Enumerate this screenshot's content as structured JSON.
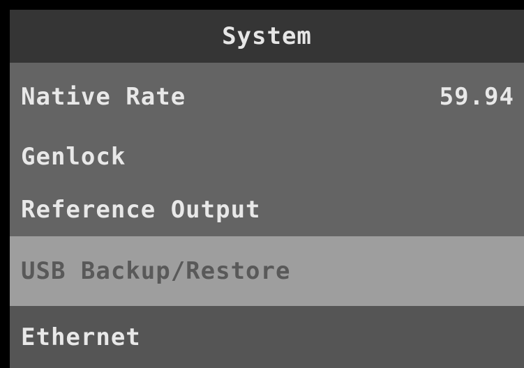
{
  "header": {
    "title": "System"
  },
  "menu": {
    "items": [
      {
        "label": "Native Rate",
        "value": "59.94"
      },
      {
        "label": "Genlock",
        "value": ""
      },
      {
        "label": "Reference Output",
        "value": ""
      },
      {
        "label": "USB Backup/Restore",
        "value": "",
        "selected": true
      },
      {
        "label": "Ethernet",
        "value": ""
      }
    ]
  },
  "colors": {
    "background": "#646464",
    "title_bar": "#353535",
    "selected_row": "#9e9e9e",
    "text": "#e8e8e8",
    "selected_text": "#595959"
  }
}
